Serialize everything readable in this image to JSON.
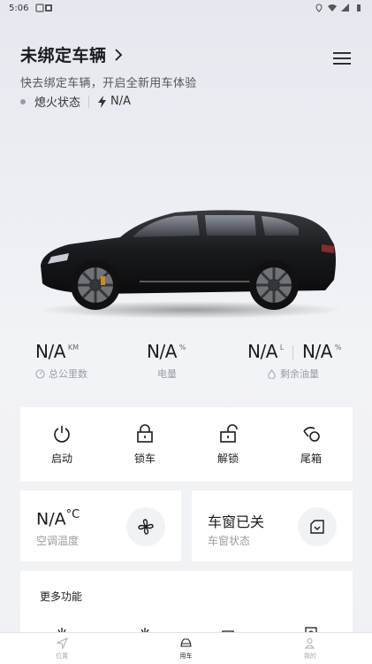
{
  "status_bar": {
    "time": "5:06"
  },
  "header": {
    "title": "未绑定车辆",
    "subtitle": "快去绑定车辆，开启全新用车体验"
  },
  "state": {
    "engine_label": "熄火状态",
    "charge_value": "N/A"
  },
  "stats": [
    {
      "value": "N/A",
      "unit": "KM",
      "label": "总公里数",
      "icon": "speedometer-icon"
    },
    {
      "value": "N/A",
      "unit": "%",
      "label": "电量"
    },
    {
      "value": "N/A",
      "unit": "L",
      "label": "剩余油量",
      "icon": "drop-icon"
    },
    {
      "value": "N/A",
      "unit": "%"
    }
  ],
  "actions": [
    {
      "label": "启动",
      "icon": "power-icon"
    },
    {
      "label": "锁车",
      "icon": "lock-icon"
    },
    {
      "label": "解锁",
      "icon": "unlock-icon"
    },
    {
      "label": "尾箱",
      "icon": "trunk-icon"
    }
  ],
  "climate": {
    "value": "N/A",
    "unit": "°C",
    "label": "空调温度",
    "icon": "fan-icon"
  },
  "window": {
    "value": "车窗已关",
    "label": "车窗状态",
    "icon": "window-icon"
  },
  "more": {
    "title": "更多功能"
  },
  "tabs": [
    {
      "label": "位置",
      "icon": "navigation-icon",
      "active": false
    },
    {
      "label": "用车",
      "icon": "car-icon",
      "active": true
    },
    {
      "label": "我的",
      "icon": "person-icon",
      "active": false
    }
  ],
  "colors": {
    "text": "#1b1c20",
    "muted": "#9a9ca3",
    "card": "#ffffff",
    "background": "#eef0f5"
  }
}
